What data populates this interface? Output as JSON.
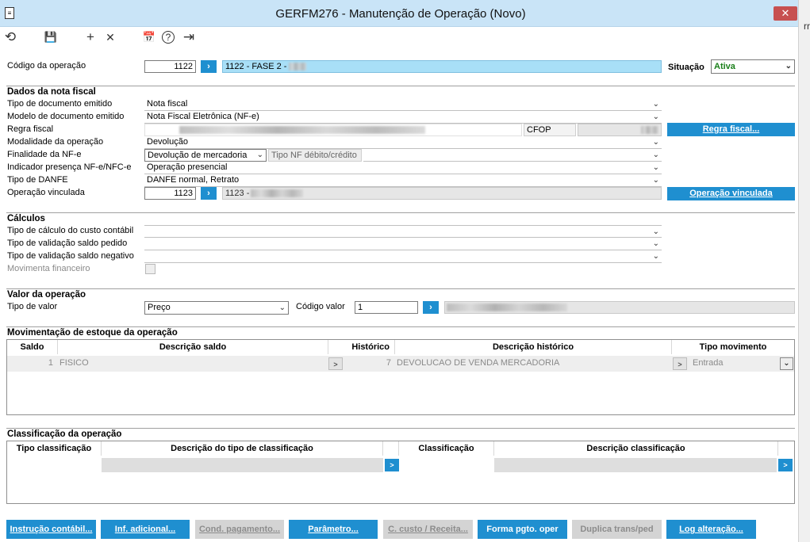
{
  "window": {
    "title": "GERFM276 - Manutenção de Operação (Novo)",
    "close_glyph": "✕",
    "side_glyph": "rr"
  },
  "toolbar": {
    "undo": "⟲",
    "save": "💾",
    "add": "+",
    "remove": "✕",
    "calendar": "📅",
    "help": "?",
    "exit": "⇥"
  },
  "header": {
    "codigo_label": "Código da operação",
    "codigo_value": "1122",
    "codigo_desc": "1122 -  FASE 2 -",
    "situacao_label": "Situação",
    "situacao_value": "Ativa"
  },
  "dados": {
    "title": "Dados da nota fiscal",
    "tipo_doc_label": "Tipo de documento emitido",
    "tipo_doc_value": "Nota fiscal",
    "modelo_label": "Modelo de documento emitido",
    "modelo_value": "Nota Fiscal Eletrônica (NF-e)",
    "regra_label": "Regra fiscal",
    "cfop_label": "CFOP",
    "regra_button": "Regra fiscal...",
    "modalidade_label": "Modalidade da operação",
    "modalidade_value": "Devolução",
    "finalidade_label": "Finalidade da NF-e",
    "finalidade_value": "Devolução de mercadoria",
    "tipo_nf_label": "Tipo NF débito/crédito",
    "indicador_label": "Indicador presença NF-e/NFC-e",
    "indicador_value": "Operação presencial",
    "danfe_label": "Tipo de DANFE",
    "danfe_value": "DANFE normal, Retrato",
    "vinculada_label": "Operação vinculada",
    "vinculada_value": "1123",
    "vinculada_desc": "1123 -",
    "vinculada_button": "Operação vinculada"
  },
  "calculos": {
    "title": "Cálculos",
    "custo_label": "Tipo de cálculo do custo contábil",
    "saldo_pedido_label": "Tipo de validação saldo pedido",
    "saldo_negativo_label": "Tipo de validação saldo negativo",
    "movimenta_label": "Movimenta financeiro"
  },
  "valor": {
    "title": "Valor da operação",
    "tipo_label": "Tipo de valor",
    "tipo_value": "Preço",
    "codigo_label": "Código valor",
    "codigo_value": "1"
  },
  "estoque": {
    "title": "Movimentação de estoque da operação",
    "columns": [
      "Saldo",
      "Descrição saldo",
      "Histórico",
      "Descrição histórico",
      "Tipo movimento"
    ],
    "row": {
      "saldo": "1",
      "descricao_saldo": "FISICO",
      "historico": "7",
      "descricao_historico": "DEVOLUCAO DE VENDA MERCADORIA",
      "tipo_movimento": "Entrada"
    }
  },
  "classificacao": {
    "title": "Classificação da operação",
    "columns": [
      "Tipo classificação",
      "Descrição do tipo de classificação",
      "Classificação",
      "Descrição classificação"
    ]
  },
  "buttons": {
    "instrucao": "Instrução contábil...",
    "inf_adicional": "Inf. adicional...",
    "cond_pagamento": "Cond. pagamento...",
    "parametro": "Parâmetro...",
    "c_custo": "C. custo / Receita...",
    "forma_pgto": "Forma pgto. oper",
    "duplica": "Duplica trans/ped",
    "log": "Log alteração..."
  },
  "glyphs": {
    "go": "›",
    "small_go": ">",
    "chevron": "⌄"
  },
  "colors": {
    "accent": "#1f8fd0",
    "titlebar": "#c9e4f7",
    "close": "#c75050",
    "active_green": "#1a7f1a"
  }
}
